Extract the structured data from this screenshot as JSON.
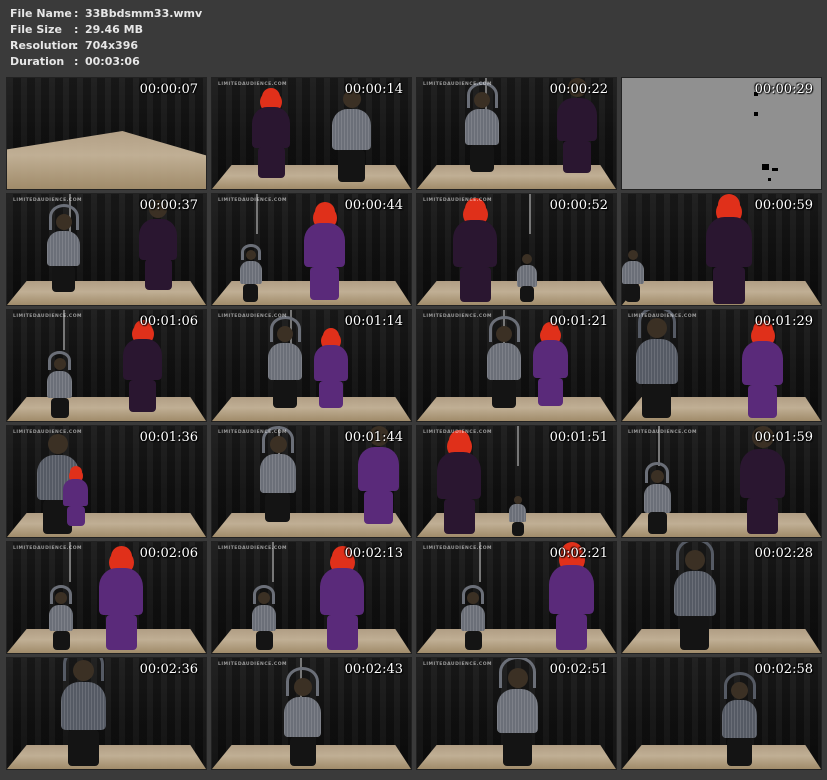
{
  "header": {
    "rows": [
      {
        "label": "File Name",
        "sep": ":",
        "value": "33Bbdsmm33.wmv"
      },
      {
        "label": "File Size",
        "sep": ":",
        "value": "29.46 MB"
      },
      {
        "label": "Resolution",
        "sep": ":",
        "value": "704x396"
      },
      {
        "label": "Duration",
        "sep": ":",
        "value": "00:03:06"
      }
    ]
  },
  "thumbnails": [
    {
      "timestamp": "00:00:07",
      "watermark": ""
    },
    {
      "timestamp": "00:00:14",
      "watermark": "LIMITEDAUDIENCE.COM"
    },
    {
      "timestamp": "00:00:22",
      "watermark": "LIMITEDAUDIENCE.COM"
    },
    {
      "timestamp": "00:00:29",
      "watermark": ""
    },
    {
      "timestamp": "00:00:37",
      "watermark": "LIMITEDAUDIENCE.COM"
    },
    {
      "timestamp": "00:00:44",
      "watermark": "LIMITEDAUDIENCE.COM"
    },
    {
      "timestamp": "00:00:52",
      "watermark": "LIMITEDAUDIENCE.COM"
    },
    {
      "timestamp": "00:00:59",
      "watermark": ""
    },
    {
      "timestamp": "00:01:06",
      "watermark": "LIMITEDAUDIENCE.COM"
    },
    {
      "timestamp": "00:01:14",
      "watermark": "LIMITEDAUDIENCE.COM"
    },
    {
      "timestamp": "00:01:21",
      "watermark": "LIMITEDAUDIENCE.COM"
    },
    {
      "timestamp": "00:01:29",
      "watermark": "LIMITEDAUDIENCE.COM"
    },
    {
      "timestamp": "00:01:36",
      "watermark": "LIMITEDAUDIENCE.COM"
    },
    {
      "timestamp": "00:01:44",
      "watermark": "LIMITEDAUDIENCE.COM"
    },
    {
      "timestamp": "00:01:51",
      "watermark": "LIMITEDAUDIENCE.COM"
    },
    {
      "timestamp": "00:01:59",
      "watermark": "LIMITEDAUDIENCE.COM"
    },
    {
      "timestamp": "00:02:06",
      "watermark": "LIMITEDAUDIENCE.COM"
    },
    {
      "timestamp": "00:02:13",
      "watermark": "LIMITEDAUDIENCE.COM"
    },
    {
      "timestamp": "00:02:21",
      "watermark": "LIMITEDAUDIENCE.COM"
    },
    {
      "timestamp": "00:02:28",
      "watermark": ""
    },
    {
      "timestamp": "00:02:36",
      "watermark": ""
    },
    {
      "timestamp": "00:02:43",
      "watermark": "LIMITEDAUDIENCE.COM"
    },
    {
      "timestamp": "00:02:51",
      "watermark": "LIMITEDAUDIENCE.COM"
    },
    {
      "timestamp": "00:02:58",
      "watermark": ""
    }
  ],
  "colors": {
    "background": "#3a3a3a",
    "text": "#e6e6e6",
    "timestamp": "#ffffff",
    "red_hair": "#e0301a",
    "purple_dress": "#5a2a7a",
    "floor": "#c2af92"
  }
}
